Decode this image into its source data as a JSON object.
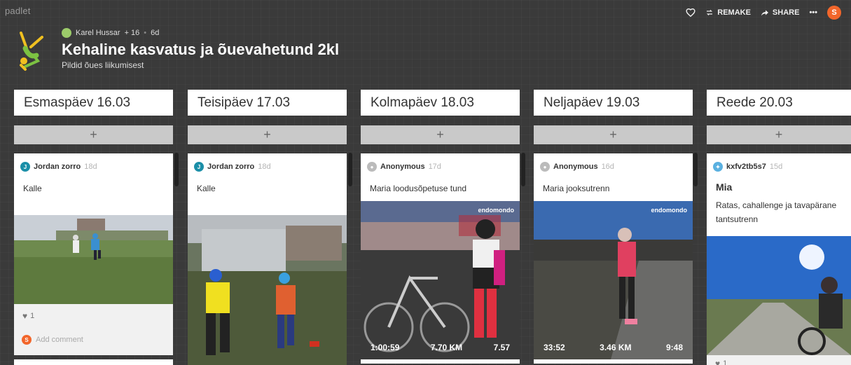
{
  "app": {
    "logo": "padlet",
    "actions": {
      "remake": "REMAKE",
      "share": "SHARE",
      "more": "•••",
      "user_initial": "S"
    }
  },
  "wall": {
    "author": "Karel Hussar",
    "plus_count": "+ 16",
    "age": "6d",
    "title": "Kehaline kasvatus ja õuevahetund 2kl",
    "subtitle": "Pildid õues liikumisest"
  },
  "columns": [
    {
      "title": "Esmaspäev 16.03",
      "add": "+",
      "card": {
        "author": "Jordan zorro",
        "initial": "J",
        "age": "18d",
        "text": "Kalle",
        "likes": "1",
        "comment_placeholder": "Add comment",
        "comment_initial": "S"
      }
    },
    {
      "title": "Teisipäev 17.03",
      "add": "+",
      "card": {
        "author": "Jordan zorro",
        "initial": "J",
        "age": "18d",
        "text": "Kalle"
      }
    },
    {
      "title": "Kolmapäev 18.03",
      "add": "+",
      "card": {
        "author": "Anonymous",
        "age": "17d",
        "text": "Maria loodusõpetuse tund",
        "badge": "endomondo",
        "stats": [
          "1:00:59",
          "7.70 KM",
          "7.57"
        ]
      }
    },
    {
      "title": "Neljapäev 19.03",
      "add": "+",
      "card": {
        "author": "Anonymous",
        "age": "16d",
        "text": "Maria jooksutrenn",
        "badge": "endomondo",
        "stats": [
          "33:52",
          "3.46 KM",
          "9:48"
        ]
      }
    },
    {
      "title": "Reede 20.03",
      "add": "+",
      "card": {
        "author": "kxfv2tb5s7",
        "age": "15d",
        "heading": "Mia",
        "text": "Ratas, cahallenge ja tavapärane tantsutrenn",
        "likes": "1"
      }
    }
  ],
  "colors": {
    "background": "#3a3a3a",
    "accent": "#f2662b",
    "teal": "#1b8fa8"
  }
}
